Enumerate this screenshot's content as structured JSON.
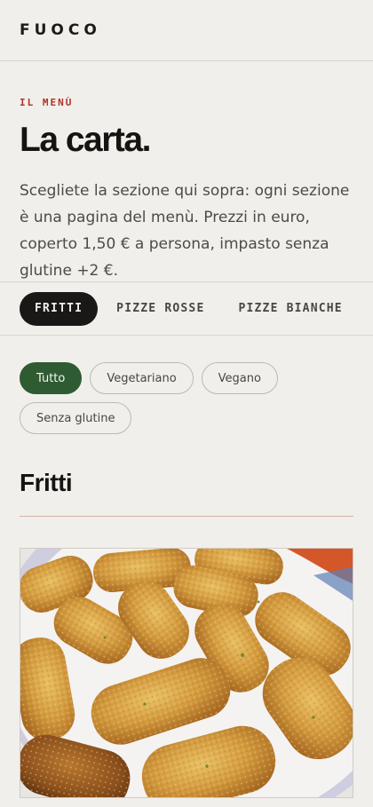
{
  "header": {
    "brand": "FUOCO"
  },
  "intro": {
    "eyebrow": "IL MENÙ",
    "title": "La carta.",
    "description": "Scegliete la sezione qui sopra: ogni sezione è una pagina del menù. Prezzi in euro, coperto 1,50 € a persona, impasto senza glutine +2 €."
  },
  "tabs": [
    {
      "label": "FRITTI",
      "active": true
    },
    {
      "label": "PIZZE ROSSE",
      "active": false
    },
    {
      "label": "PIZZE BIANCHE",
      "active": false
    }
  ],
  "filters": [
    {
      "label": "Tutto",
      "active": true
    },
    {
      "label": "Vegetariano",
      "active": false
    },
    {
      "label": "Vegano",
      "active": false
    },
    {
      "label": "Senza glutine",
      "active": false
    }
  ],
  "section": {
    "title": "Fritti"
  },
  "image": {
    "subject": "crocchette-fritte"
  },
  "colors": {
    "accent_red": "#b0342b",
    "active_tab": "#191816",
    "active_filter": "#2f5b33",
    "background": "#f1efeb"
  }
}
